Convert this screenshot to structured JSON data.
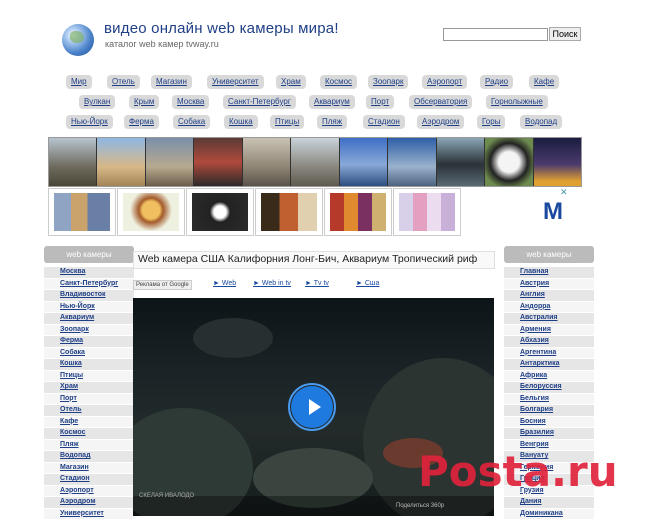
{
  "header": {
    "title": "видео онлайн web камеры мира!",
    "subtitle": "каталог web камер tvway.ru",
    "search_placeholder": "",
    "search_button": "Поиск"
  },
  "tags": [
    "Мир",
    "Отель",
    "Магазин",
    "Университет",
    "Храм",
    "Космос",
    "Зоопарк",
    "Аэропорт",
    "Радио",
    "Кафе",
    "Вулкан",
    "Крым",
    "Москва",
    "Санкт-Петербург",
    "Аквариум",
    "Порт",
    "Обсерватория",
    "Горнолыжные",
    "Нью-Йорк",
    "Ферма",
    "Собака",
    "Кошка",
    "Птицы",
    "Пляж",
    "Стадион",
    "Аэродром",
    "Горы",
    "Водопад"
  ],
  "ad": {
    "close": "✕",
    "brand_letter": "M"
  },
  "left_sidebar": {
    "heading": "web камеры",
    "items": [
      "Москва",
      "Санкт-Петербург",
      "Владивосток",
      "Нью-Йорк",
      "Аквариум",
      "Зоопарк",
      "Ферма",
      "Собака",
      "Кошка",
      "Птицы",
      "Храм",
      "Порт",
      "Отель",
      "Кафе",
      "Космос",
      "Пляж",
      "Водопад",
      "Магазин",
      "Стадион",
      "Аэропорт",
      "Аэродром",
      "Университет"
    ]
  },
  "right_sidebar": {
    "heading": "web камеры",
    "items": [
      "Главная",
      "Австрия",
      "Англия",
      "Андорра",
      "Австралия",
      "Армения",
      "Абхазия",
      "Аргентина",
      "Антарктика",
      "Африка",
      "Белоруссия",
      "Бельгия",
      "Болгария",
      "Босния",
      "Бразилия",
      "Венгрия",
      "Вануату",
      "Германия",
      "Греция",
      "Грузия",
      "Дания",
      "Доминикана"
    ]
  },
  "main": {
    "title": "Web камера США Калифорния Лонг-Бич, Аквариум Тропический риф",
    "ads_by": "Реклама от Google",
    "ad_links": [
      "► Web",
      "► Web in tv",
      "► Tv tv",
      "► Сша"
    ],
    "video_share": "Поделиться  360p",
    "video_cam_label": "СКЕЛАЯ  ИВАЛОДО"
  },
  "watermark": "Posta.ru",
  "colors": {
    "link": "#1f3f86",
    "tag_bg": "#d9d9d9",
    "play_button": "#1f7ae0",
    "watermark": "#e0233c"
  }
}
